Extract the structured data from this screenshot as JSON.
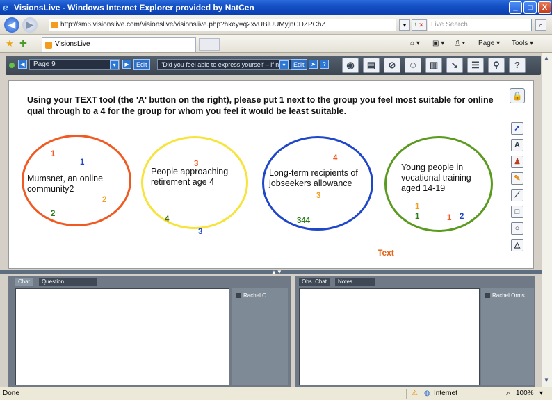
{
  "window": {
    "title": "VisionsLive - Windows Internet Explorer provided by NatCen",
    "min": "_",
    "max": "□",
    "close": "X"
  },
  "address": {
    "url": "http://sm6.visionslive.com/visionslive/visionslive.php?hkey=q2xvUBlUUMyjnCDZPChZ",
    "search_placeholder": "Live Search"
  },
  "tabs": {
    "active_label": "VisionsLive",
    "page_label": "Page",
    "tools_label": "Tools"
  },
  "app": {
    "page_select": "Page 9",
    "edit_label": "Edit",
    "question_select": "\"Did you feel able to express yourself – if n",
    "board": {
      "instruction": "Using your TEXT tool (the 'A' button on the right), please put 1 next to the group you feel most suitable for online qual through to a 4 for the group for whom you feel it would be least suitable.",
      "groups": [
        {
          "label": "Mumsnet, an online community2",
          "color": "#f05a22"
        },
        {
          "label": "People approaching retirement age 4",
          "color": "#f7e43a"
        },
        {
          "label": "Long-term recipients of jobseekers allowance",
          "color": "#1f47c8"
        },
        {
          "label": "Young people in vocational training aged 14-19",
          "color": "#5a9a1e"
        }
      ],
      "numbers": {
        "g1": [
          "1",
          "1",
          "2",
          "2"
        ],
        "g2": [
          "3",
          "4",
          "3"
        ],
        "g3": [
          "4",
          "3",
          "344"
        ],
        "g4": [
          "1",
          "1",
          "1",
          "2"
        ]
      },
      "text_label": "Text",
      "tools": [
        "pointer-icon",
        "text-icon",
        "stamp-icon",
        "pencil-icon",
        "line-icon",
        "rectangle-icon",
        "circle-icon",
        "triangle-icon"
      ]
    },
    "panels": {
      "left_tabs": [
        "Chat",
        "Question"
      ],
      "left_user": "Rachel O",
      "right_tabs": [
        "Obs. Chat",
        "Notes"
      ],
      "right_user": "Rachel Orms"
    }
  },
  "status": {
    "left": "Done",
    "zone": "Internet",
    "zoom": "100%"
  }
}
